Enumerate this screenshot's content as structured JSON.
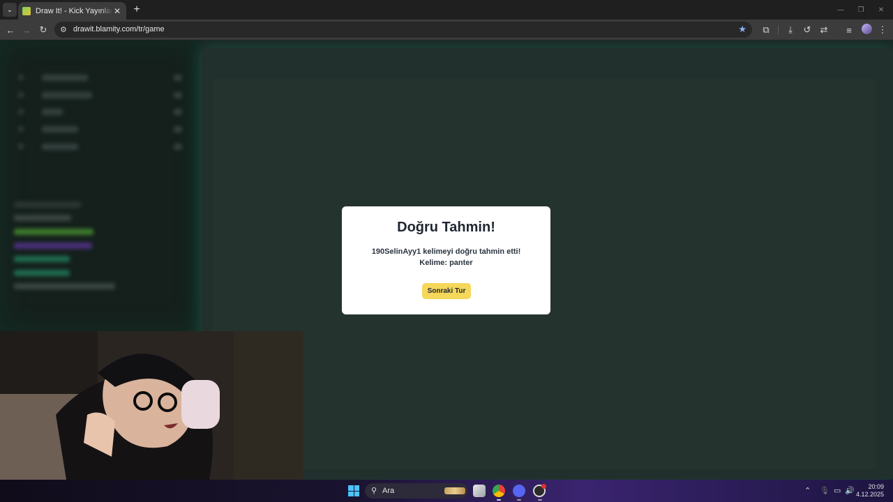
{
  "browser": {
    "tab_title": "Draw It! - Kick Yayınları İçin Çizim",
    "tab_close": "✕",
    "new_tab": "+",
    "url": "drawit.blamity.com/tr/game"
  },
  "modal": {
    "title": "Doğru Tahmin!",
    "message": "190SelinAyy1 kelimeyi doğru tahmin etti! Kelime: panter",
    "button_label": "Sonraki Tur"
  },
  "taskbar": {
    "search_label": "Ara",
    "time": "20:09",
    "date": "4.12.2025"
  },
  "colors": {
    "accent_button": "#f5d75a",
    "page_background": "#1b2523",
    "canvas_glow": "#1ea078"
  }
}
